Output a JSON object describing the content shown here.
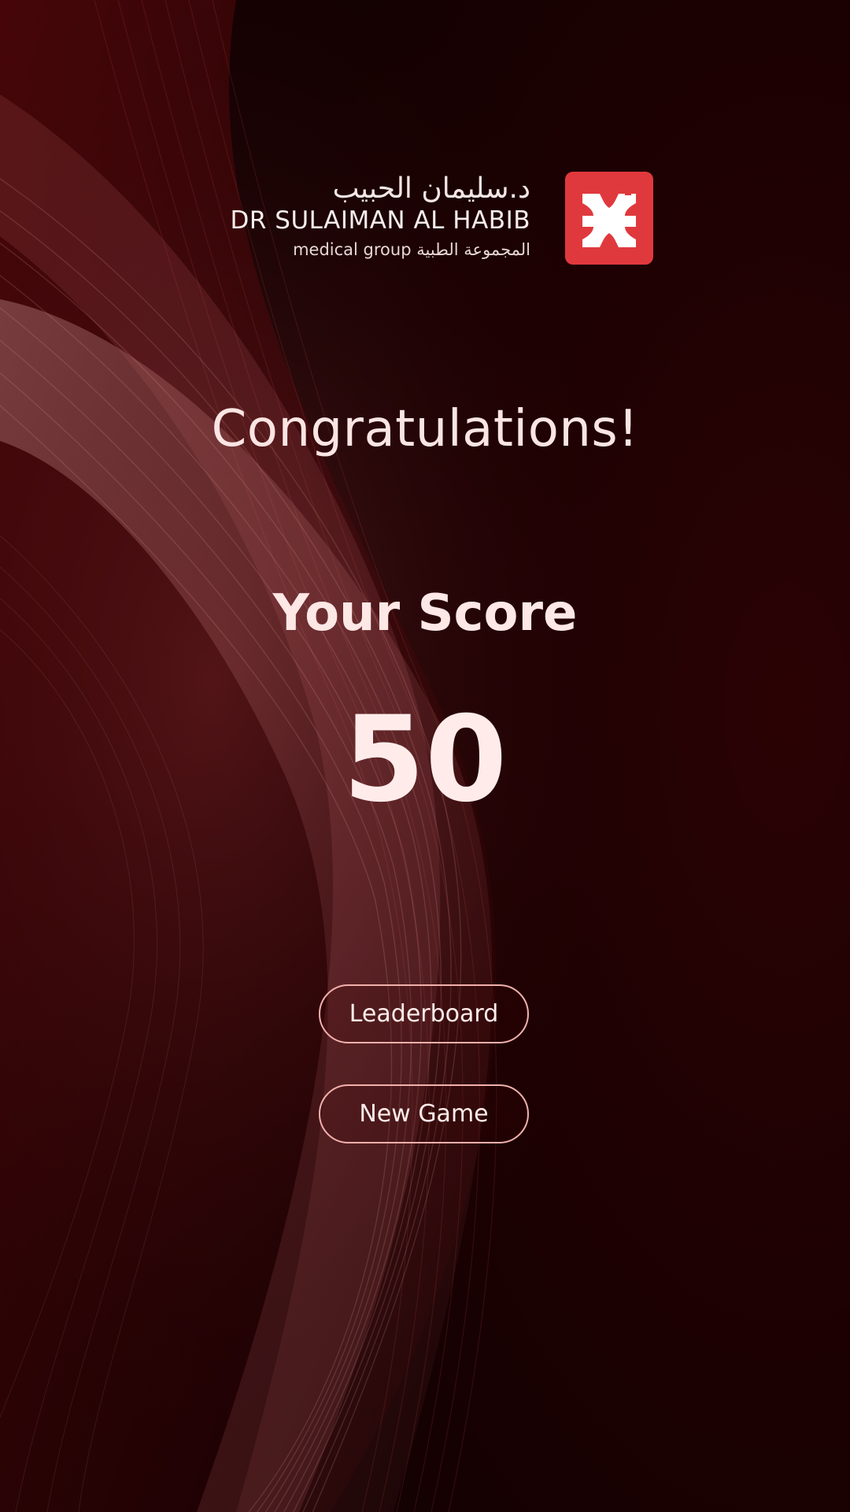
{
  "brand": {
    "arabic_name": "د.سليمان الحبيب",
    "english_name": "DR SULAIMAN AL HABIB",
    "sub_label": "medical group المجموعة الطبية",
    "logo_color": "#e0393d",
    "logo_icon": "dr-sulaiman-al-habib-logo-mark"
  },
  "result": {
    "headline": "Congratulations!",
    "score_label": "Your Score",
    "score_value": "50"
  },
  "actions": {
    "leaderboard_label": "Leaderboard",
    "new_game_label": "New Game"
  },
  "colors": {
    "background": "#1e0203",
    "accent_wave": "#8a1a1e",
    "button_border": "#f2b0ac",
    "text": "#fde8e6"
  }
}
